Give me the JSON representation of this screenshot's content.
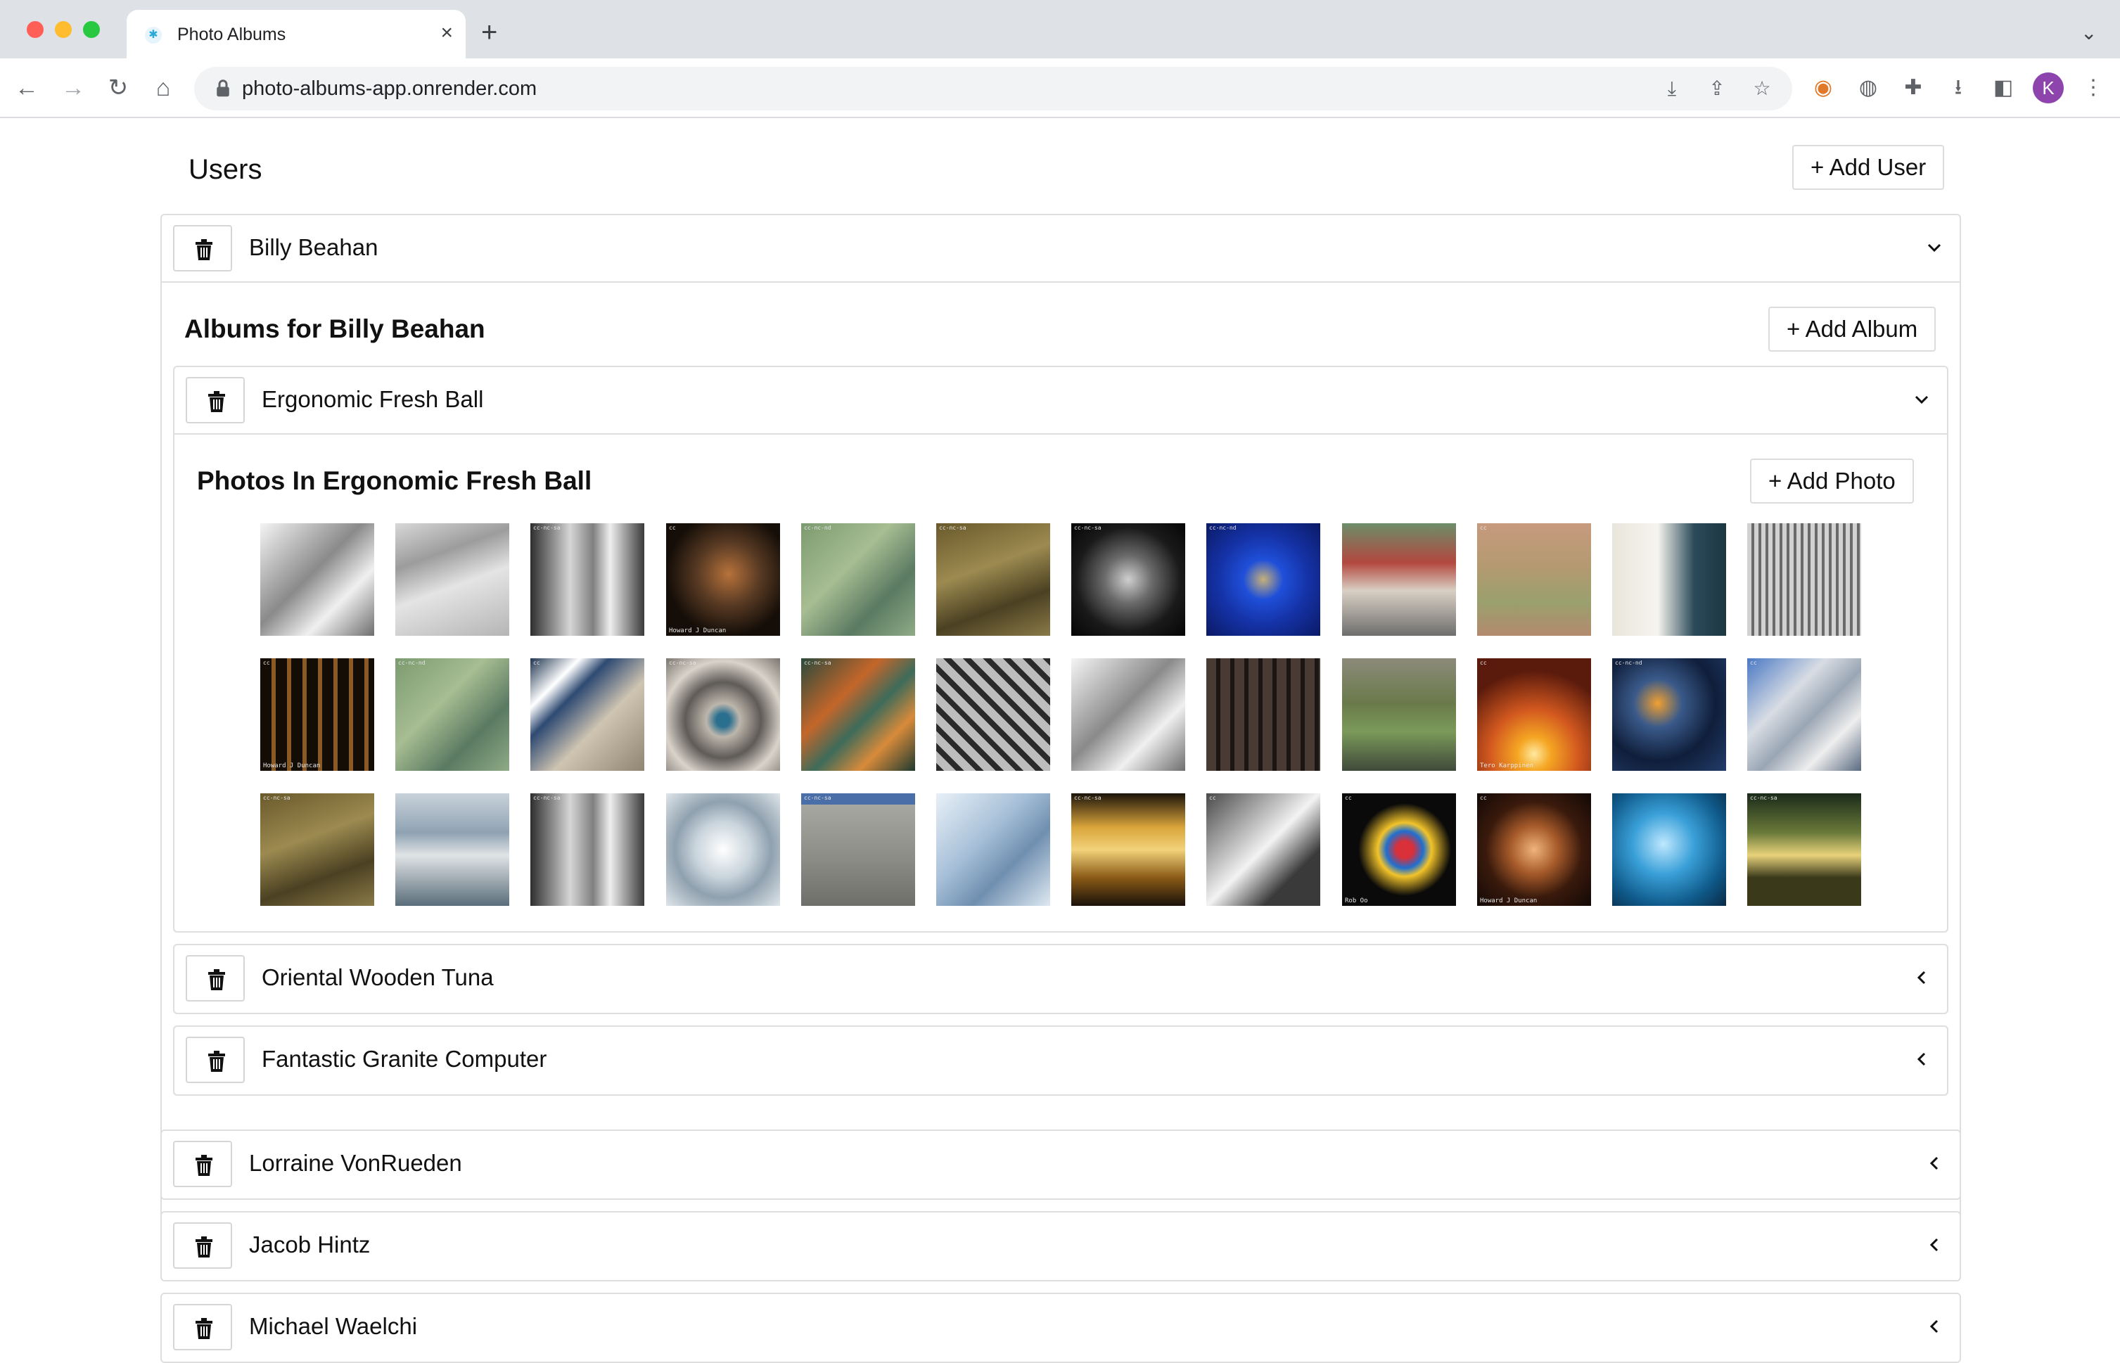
{
  "browser": {
    "tab_title": "Photo Albums",
    "url": "photo-albums-app.onrender.com",
    "profile_initial": "K",
    "icons": {
      "back": "arrow-left-icon",
      "forward": "arrow-right-icon",
      "reload": "reload-icon",
      "home": "home-icon"
    }
  },
  "users": {
    "title": "Users",
    "add_user_label": "+ Add User",
    "list": [
      {
        "name": "Billy Beahan",
        "expanded": true,
        "albums_title": "Albums for Billy Beahan",
        "add_album_label": "+ Add Album",
        "albums": [
          {
            "name": "Ergonomic Fresh Ball",
            "expanded": true,
            "photos_title": "Photos In Ergonomic Fresh Ball",
            "add_photo_label": "+ Add Photo"
          },
          {
            "name": "Oriental Wooden Tuna",
            "expanded": false
          },
          {
            "name": "Fantastic Granite Computer",
            "expanded": false
          }
        ]
      },
      {
        "name": "Lorraine VonRueden",
        "expanded": false
      },
      {
        "name": "Jacob Hintz",
        "expanded": false
      },
      {
        "name": "Michael Waelchi",
        "expanded": false
      }
    ]
  },
  "photos": [
    {
      "subject": "white abstract swirls",
      "bg": "linear-gradient(135deg,#f4f4f4,#8a8a8a 45%,#f0f0f0 70%,#6e6e6e)",
      "caption": "",
      "license": ""
    },
    {
      "subject": "stone staircase",
      "bg": "linear-gradient(160deg,#d8d8d8,#9c9c9c 30%,#e4e4e4 55%,#b5b5b5)",
      "caption": "",
      "license": ""
    },
    {
      "subject": "icicle column",
      "bg": "linear-gradient(90deg,#2e2e2e,#d6d6d6 35%,#7f7f7f 55%,#efefef 70%,#3a3a3a)",
      "caption": "",
      "license": "cc-nc-sa"
    },
    {
      "subject": "brown fractal",
      "bg": "radial-gradient(circle at 55% 45%,#b7723b,#5a3b24 35%,#150e08 70%)",
      "caption": "Howard J Duncan",
      "license": "cc"
    },
    {
      "subject": "green leaf pattern",
      "bg": "linear-gradient(135deg,#7c9b70,#a7bd92 40%,#5a7a62 70%,#8fab86)",
      "caption": "",
      "license": "cc-nc-nd"
    },
    {
      "subject": "thatched roof",
      "bg": "linear-gradient(160deg,#6a5a2c,#9c8a50 40%,#4b4122 70%,#8a7a48)",
      "caption": "",
      "license": "cc-nc-sa"
    },
    {
      "subject": "dark rose",
      "bg": "radial-gradient(circle at 50% 50%,#cfcfcf,#6a6a6a 30%,#1a1a1a 65%,#050505)",
      "caption": "",
      "license": "cc-nc-sa"
    },
    {
      "subject": "blue fractal",
      "bg": "radial-gradient(circle at 50% 50%,#c6b07a,#1f4fd9 25%,#1533a8 55%,#0b1a66)",
      "caption": "",
      "license": "cc-nc-nd"
    },
    {
      "subject": "liquor store",
      "bg": "linear-gradient(180deg,#6c8e6a,#b3483f 35%,#d9d0c4 60%,#6e6e6e)",
      "caption": "",
      "license": ""
    },
    {
      "subject": "duck on water",
      "bg": "linear-gradient(180deg,#c79a7e,#b39a70 40%,#9aa06e 70%,#b38a6e)",
      "caption": "",
      "license": "cc"
    },
    {
      "subject": "building window",
      "bg": "linear-gradient(90deg,#e9e6dc,#f6f4ee 40%,#2b4a5a 72%,#1d3642)",
      "caption": "",
      "license": "cc"
    },
    {
      "subject": "striped ceiling",
      "bg": "repeating-linear-gradient(90deg,#d2d2d2 0 6px,#6a6a6a 6px 10px)",
      "caption": "",
      "license": ""
    },
    {
      "subject": "wooden sticks",
      "bg": "repeating-linear-gradient(90deg,#130d06 0 16px,#8a5a26 16px 22px)",
      "caption": "Howard J Duncan",
      "license": "cc"
    },
    {
      "subject": "green leaf pattern",
      "bg": "linear-gradient(135deg,#7c9b70,#a7bd92 40%,#5a7a62 70%,#8fab86)",
      "caption": "",
      "license": "cc-nc-nd"
    },
    {
      "subject": "architecture sky",
      "bg": "linear-gradient(135deg,#1f3550,#ffffff 22%,#2e4a72 35%,#cfc4b2 60%,#8f8572)",
      "caption": "",
      "license": "cc"
    },
    {
      "subject": "round dome",
      "bg": "radial-gradient(circle at 50% 55%,#2a6f8e 0 8%,#bdb6ac 20%,#5f5b57 45%,#d9d3ca 70%,#7a756f)",
      "caption": "",
      "license": "cc-nc-sa"
    },
    {
      "subject": "orange green fractal",
      "bg": "linear-gradient(135deg,#2b4a3c,#c4662a 35%,#3d6b5a 55%,#d88a3a 75%,#1e3a30)",
      "caption": "",
      "license": "cc-nc-sa"
    },
    {
      "subject": "paving bricks",
      "bg": "repeating-linear-gradient(45deg,#2a2a2a 0 8px,#bdbdbd 8px 20px)",
      "caption": "",
      "license": ""
    },
    {
      "subject": "white abstract swirls",
      "bg": "linear-gradient(135deg,#f4f4f4,#8a8a8a 45%,#f0f0f0 70%,#6e6e6e)",
      "caption": "",
      "license": ""
    },
    {
      "subject": "brick building",
      "bg": "repeating-linear-gradient(90deg,#4a3a34 0 14px,#1a1614 14px 20px)",
      "caption": "",
      "license": ""
    },
    {
      "subject": "forest stream",
      "bg": "linear-gradient(180deg,#8c8a7a,#6a7a4a 40%,#7b9a5a 65%,#3f4a3a)",
      "caption": "",
      "license": ""
    },
    {
      "subject": "orange burst",
      "bg": "radial-gradient(circle at 50% 85%,#ffe9a0,#f5a623 15%,#d2581f 40%,#5a1a0c 75%)",
      "caption": "Tero Karppinen",
      "license": "cc"
    },
    {
      "subject": "blue cells",
      "bg": "radial-gradient(circle at 40% 40%,#f0a030,#3a5a8a 25%,#0f1e3a 60%,#233d6a)",
      "caption": "",
      "license": "cc-nc-nd"
    },
    {
      "subject": "curved building",
      "bg": "linear-gradient(135deg,#4a78c4,#d8dde4 35%,#9aa6b4 55%,#eeeeee 75%,#5a6a80)",
      "caption": "",
      "license": "cc"
    },
    {
      "subject": "thatched roof",
      "bg": "linear-gradient(160deg,#6a5a2c,#9c8a50 40%,#4b4122 70%,#8a7a48)",
      "caption": "",
      "license": "cc-nc-sa"
    },
    {
      "subject": "cloudy sea",
      "bg": "linear-gradient(180deg,#c8d2da,#8fa2b2 35%,#e0e4e6 55%,#5a6d7a)",
      "caption": "",
      "license": ""
    },
    {
      "subject": "icicle column",
      "bg": "linear-gradient(90deg,#2e2e2e,#d6d6d6 35%,#7f7f7f 55%,#efefef 70%,#3a3a3a)",
      "caption": "",
      "license": "cc-nc-sa"
    },
    {
      "subject": "geodesic dome",
      "bg": "radial-gradient(circle at 50% 50%,#ffffff,#c9d4dc 35%,#8fa0ae 60%,#dfe6ea)",
      "caption": "",
      "license": ""
    },
    {
      "subject": "grey wall",
      "bg": "linear-gradient(180deg,#4a6ea8 0 10%,#a7a7a2 10%,#8b8b86 60%,#6e6e6a)",
      "caption": "",
      "license": "cc-nc-sa"
    },
    {
      "subject": "frost crystals",
      "bg": "linear-gradient(135deg,#e8f0f7,#a7c0d8 40%,#6f8fb0 65%,#dfe9f2)",
      "caption": "",
      "license": ""
    },
    {
      "subject": "amber glass",
      "bg": "linear-gradient(180deg,#1a140a,#d9a43a 30%,#f2d27a 50%,#8a5a16 75%,#1a120a)",
      "caption": "",
      "license": "cc-nc-sa"
    },
    {
      "subject": "beach waves",
      "bg": "linear-gradient(135deg,#4a4a4a,#bfbfbf 35%,#f3f3f3 50%,#3a3a3a 75%)",
      "caption": "",
      "license": "cc"
    },
    {
      "subject": "stained glass",
      "bg": "radial-gradient(circle at 55% 50%,#d9303a 0 10%,#1f6fd0 22%,#f2c32a 32%,#0a0a0a 55%)",
      "caption": "Rob Oo",
      "license": "cc"
    },
    {
      "subject": "brown swirl",
      "bg": "radial-gradient(circle at 50% 50%,#f0b47a,#a65a2a 30%,#3a1a0c 60%,#120806)",
      "caption": "Howard J Duncan",
      "license": "cc"
    },
    {
      "subject": "blue bubbles",
      "bg": "radial-gradient(circle at 45% 45%,#bfe8ff,#3aa0d8 35%,#0f5a8a 70%,#0a2a46)",
      "caption": "",
      "license": ""
    },
    {
      "subject": "couple at sunset",
      "bg": "linear-gradient(180deg,#1a2a1a,#6a7a3a 35%,#e8d27a 55%,#3a3a1a 75%)",
      "caption": "",
      "license": "cc-nc-sa"
    }
  ],
  "colors": {
    "border": "#dedede",
    "text": "#111111",
    "chrome_tab_bar": "#dee1e6",
    "avatar": "#8e44ad"
  }
}
